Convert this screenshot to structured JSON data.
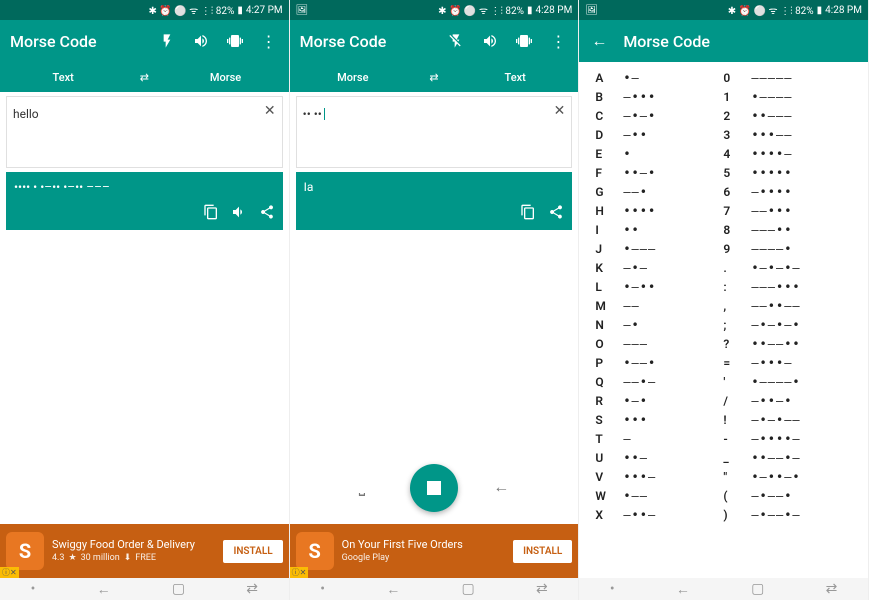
{
  "status": {
    "icons": "✱ ⏰ ⚪ ᯤ ⋮⫶ 82%",
    "time": "4:27 PM",
    "time2": "4:28 PM",
    "time3": "4:28 PM",
    "extra": "🖼"
  },
  "app": {
    "title": "Morse Code"
  },
  "screen1": {
    "tabLeft": "Text",
    "tabRight": "Morse",
    "input": "hello",
    "output": "•••• • •–•• •–•• –––"
  },
  "screen2": {
    "tabLeft": "Morse",
    "tabRight": "Text",
    "input": "•• ••",
    "output": "Ia"
  },
  "ad1": {
    "title": "Swiggy Food Order & Delivery",
    "rating": "4.3",
    "installs": "30 million",
    "free": "FREE",
    "btn": "INSTALL"
  },
  "ad2": {
    "title": "On Your First Five Orders",
    "sub": "Google Play",
    "btn": "INSTALL"
  },
  "morseTable": [
    {
      "l": "A",
      "lc": "•–",
      "r": "0",
      "rc": "–––––"
    },
    {
      "l": "B",
      "lc": "–•••",
      "r": "1",
      "rc": "•––––"
    },
    {
      "l": "C",
      "lc": "–•–•",
      "r": "2",
      "rc": "••–––"
    },
    {
      "l": "D",
      "lc": "–••",
      "r": "3",
      "rc": "•••––"
    },
    {
      "l": "E",
      "lc": "•",
      "r": "4",
      "rc": "••••–"
    },
    {
      "l": "F",
      "lc": "••–•",
      "r": "5",
      "rc": "•••••"
    },
    {
      "l": "G",
      "lc": "––•",
      "r": "6",
      "rc": "–••••"
    },
    {
      "l": "H",
      "lc": "••••",
      "r": "7",
      "rc": "––•••"
    },
    {
      "l": "I",
      "lc": "••",
      "r": "8",
      "rc": "–––••"
    },
    {
      "l": "J",
      "lc": "•–––",
      "r": "9",
      "rc": "––––•"
    },
    {
      "l": "K",
      "lc": "–•–",
      "r": ".",
      "rc": "•–•–•–"
    },
    {
      "l": "L",
      "lc": "•–••",
      "r": ":",
      "rc": "–––•••"
    },
    {
      "l": "M",
      "lc": "––",
      "r": ",",
      "rc": "––••––"
    },
    {
      "l": "N",
      "lc": "–•",
      "r": ";",
      "rc": "–•–•–•"
    },
    {
      "l": "O",
      "lc": "–––",
      "r": "?",
      "rc": "••––••"
    },
    {
      "l": "P",
      "lc": "•––•",
      "r": "=",
      "rc": "–•••–"
    },
    {
      "l": "Q",
      "lc": "––•–",
      "r": "'",
      "rc": "•––––•"
    },
    {
      "l": "R",
      "lc": "•–•",
      "r": "/",
      "rc": "–••–•"
    },
    {
      "l": "S",
      "lc": "•••",
      "r": "!",
      "rc": "–•–•––"
    },
    {
      "l": "T",
      "lc": "–",
      "r": "-",
      "rc": "–••••–"
    },
    {
      "l": "U",
      "lc": "••–",
      "r": "_",
      "rc": "••––•–"
    },
    {
      "l": "V",
      "lc": "•••–",
      "r": "\"",
      "rc": "•–••–•"
    },
    {
      "l": "W",
      "lc": "•––",
      "r": "(",
      "rc": "–•––•"
    },
    {
      "l": "X",
      "lc": "–••–",
      "r": ")",
      "rc": "–•––•–"
    }
  ]
}
